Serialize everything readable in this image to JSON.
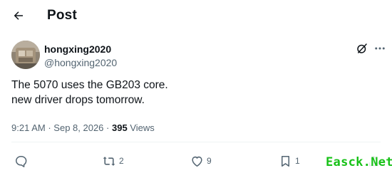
{
  "header": {
    "title": "Post",
    "back_icon": "arrow-left-icon"
  },
  "author": {
    "display_name": "hongxing2020",
    "handle": "@hongxing2020",
    "avatar_icon": "avatar-photo"
  },
  "tweet": {
    "lines": [
      "The 5070 uses the GB203 core.",
      "new driver drops tomorrow."
    ]
  },
  "meta": {
    "time": "9:21 AM",
    "separator": "·",
    "date": "Sep 8, 2026",
    "views_count": "395",
    "views_label": "Views"
  },
  "actions": {
    "reply_icon": "reply-icon",
    "reply_count": "",
    "repost_icon": "repost-icon",
    "repost_count": "2",
    "like_icon": "heart-icon",
    "like_count": "9",
    "bookmark_icon": "bookmark-icon",
    "bookmark_count": "1",
    "share_icon": "share-icon"
  },
  "watermark": {
    "text": "Easck.Net"
  },
  "colors": {
    "text_primary": "#0f1419",
    "text_secondary": "#536471",
    "divider": "#eff3f4",
    "watermark": "#17c117"
  }
}
